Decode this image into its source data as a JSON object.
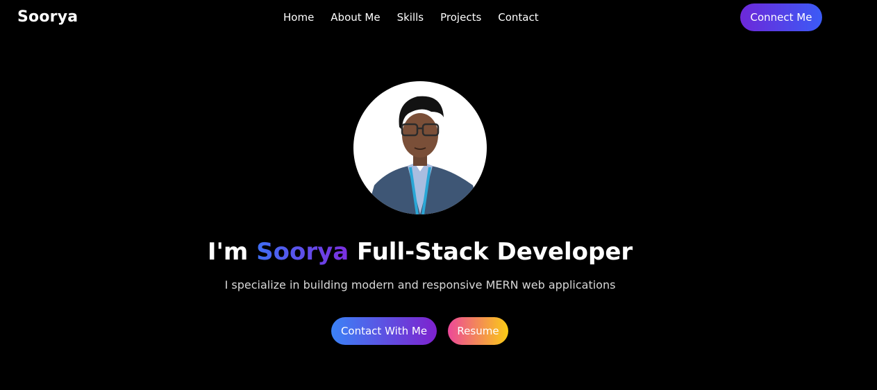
{
  "header": {
    "logo": "Soorya",
    "nav": [
      "Home",
      "About Me",
      "Skills",
      "Projects",
      "Contact"
    ],
    "cta_label": "Connect Me"
  },
  "hero": {
    "headline_prefix": "I'm ",
    "headline_name": "Soorya",
    "headline_suffix": " Full-Stack Developer",
    "subtitle": "I specialize in building modern and responsive MERN web applications",
    "primary_button": "Contact With Me",
    "secondary_button": "Resume"
  },
  "colors": {
    "background": "#000000",
    "accent_purple": "#6d28d9",
    "accent_blue": "#3b5bf6",
    "resume_pink": "#ec4899",
    "resume_yellow": "#facc15"
  }
}
